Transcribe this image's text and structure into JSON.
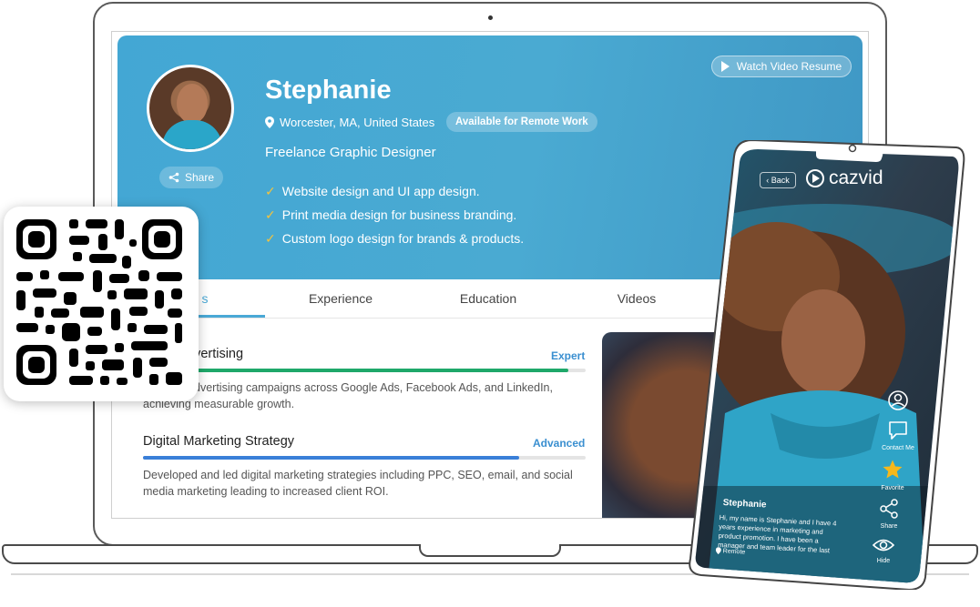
{
  "profile": {
    "name": "Stephanie",
    "location": "Worcester, MA, United States",
    "remote_badge": "Available for Remote Work",
    "job_title": "Freelance Graphic Designer",
    "share_label": "Share",
    "watch_video_label": "Watch Video Resume",
    "bullets": [
      "Website design and UI app design.",
      "Print media design for business branding.",
      "Custom logo design for brands & products."
    ]
  },
  "tabs": {
    "skills_partial": "s",
    "experience": "Experience",
    "education": "Education",
    "videos": "Videos"
  },
  "skills": [
    {
      "title_visible": "dvertising",
      "level": "Expert",
      "progress": 0.96,
      "color": "#1fa86a",
      "desc_line1": "dvertising campaigns across Google Ads, Facebook Ads, and LinkedIn,",
      "desc_line2": "achieving measurable growth."
    },
    {
      "title": "Digital Marketing Strategy",
      "level": "Advanced",
      "progress": 0.85,
      "color": "#3a7fd8",
      "desc_line1": "Developed and led digital marketing strategies including PPC, SEO, email, and social",
      "desc_line2": "media marketing leading to increased client ROI."
    }
  ],
  "phone": {
    "back_label": "Back",
    "brand": "cazvid",
    "name": "Stephanie",
    "bio_lines": [
      "Hi, my name is Stephanie and I have 4",
      "years experience in marketing and",
      "product promotion. I have been a",
      "manager and team leader for the last"
    ],
    "location": "Remote",
    "actions": {
      "contact": "Contact Me",
      "favorite": "Favorite",
      "share": "Share",
      "hide": "Hide"
    }
  },
  "colors": {
    "hero_blue": "#45a8d4",
    "check_yellow": "#f5c33b",
    "link_blue": "#3a8fd0",
    "star_gold": "#f6b81c"
  },
  "icons": [
    "location-pin-icon",
    "share-icon",
    "play-icon",
    "check-icon",
    "qr-code",
    "profile-icon",
    "chat-icon",
    "star-icon",
    "share-nodes-icon",
    "eye-icon",
    "cazvid-logo-icon"
  ]
}
